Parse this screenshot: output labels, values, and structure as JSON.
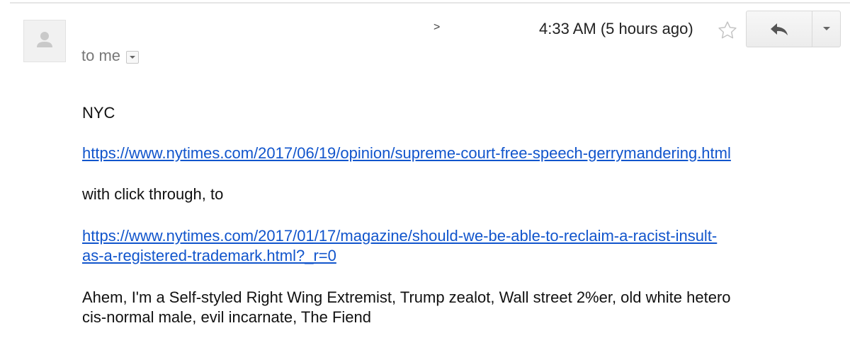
{
  "header": {
    "recipient_label": "to me",
    "expand_arrow": ">",
    "timestamp": "4:33 AM (5 hours ago)",
    "icons": {
      "avatar": "person-silhouette-icon",
      "recipient_dropdown": "dropdown-caret-icon",
      "star": "star-outline-icon",
      "reply": "reply-arrow-icon",
      "more": "chevron-down-icon"
    }
  },
  "message": {
    "line1": "NYC",
    "link1": "https://www.nytimes.com/2017/06/19/opinion/supreme-court-free-speech-gerrymandering.html",
    "line2": "with click through, to",
    "link2_part1": "https://www.nytimes.com/2017/01/17/magazine/should-we-be-able-to-reclaim-a-racist-insult-",
    "link2_part2": "as-a-registered-trademark.html?_r=0",
    "signoff_part1": "Ahem, I'm a Self-styled Right Wing Extremist, Trump zealot, Wall street 2%er, old white hetero",
    "signoff_part2": "cis-normal male, evil incarnate, The Fiend"
  },
  "colors": {
    "link": "#1155cc",
    "meta_text": "#777777",
    "divider": "#e5e5e5"
  }
}
